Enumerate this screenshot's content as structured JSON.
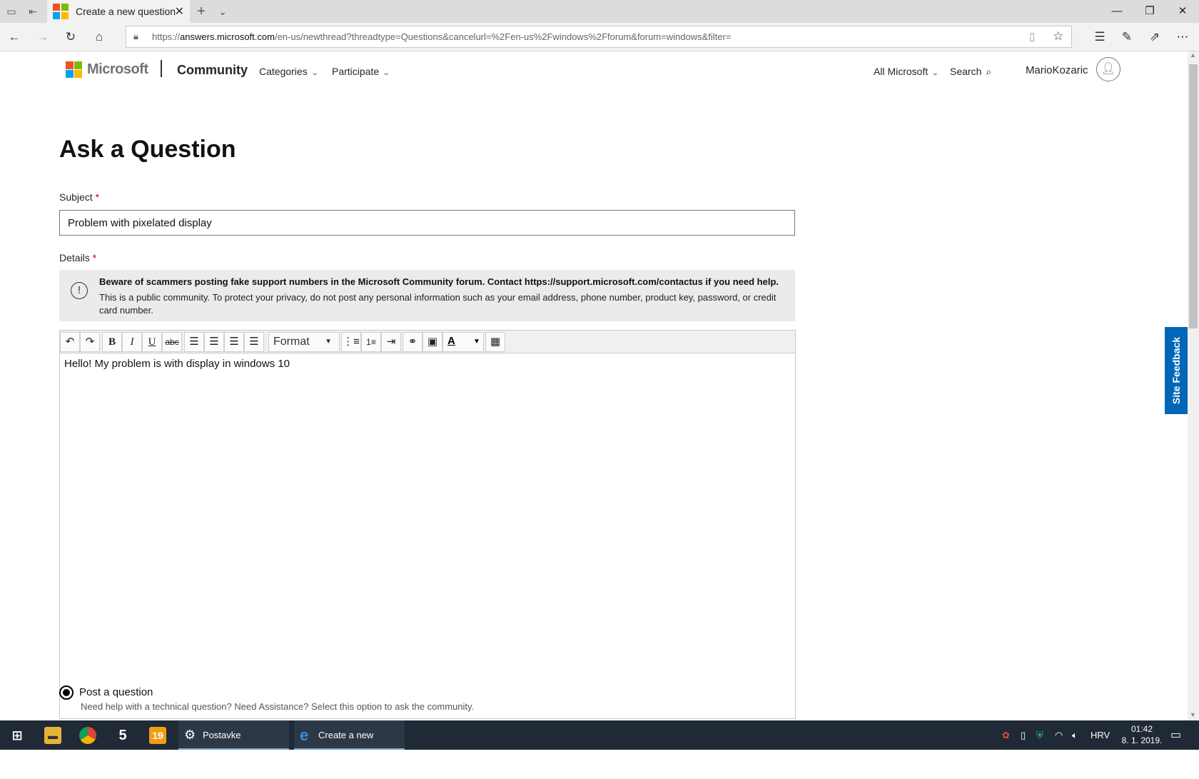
{
  "browser": {
    "tab_title": "Create a new question c",
    "url_prefix": "https://",
    "url_host": "answers.microsoft.com",
    "url_path": "/en-us/newthread?threadtype=Questions&cancelurl=%2Fen-us%2Fwindows%2Fforum&forum=windows&filter="
  },
  "header": {
    "brand": "Microsoft",
    "community": "Community",
    "nav": [
      "Categories",
      "Participate"
    ],
    "all_microsoft": "All Microsoft",
    "search": "Search",
    "username": "MarioKozaric"
  },
  "form": {
    "title": "Ask a Question",
    "subject_label": "Subject",
    "required_mark": "*",
    "subject_value": "Problem with pixelated display",
    "details_label": "Details",
    "notice_bold": "Beware of scammers posting fake support numbers in the Microsoft Community forum. Contact https://support.microsoft.com/contactus if you need help.",
    "notice_text": "This is a public community. To protect your privacy, do not post any personal information such as your email address, phone number, product key, password, or credit card number.",
    "format_label": "Format",
    "editor_text": "Hello! My problem is with display in windows 10",
    "option_label": "Post a question",
    "option_desc": "Need help with a technical question? Need Assistance? Select this option to ask the community."
  },
  "feedback_tab": "Site Feedback",
  "taskbar": {
    "settings_label": "Postavke",
    "edge_label": "Create a new questi...",
    "language": "HRV",
    "time": "01:42",
    "date": "8. 1. 2019."
  },
  "colors": {
    "accent": "#0067b8",
    "taskbar": "#1f2a36"
  }
}
